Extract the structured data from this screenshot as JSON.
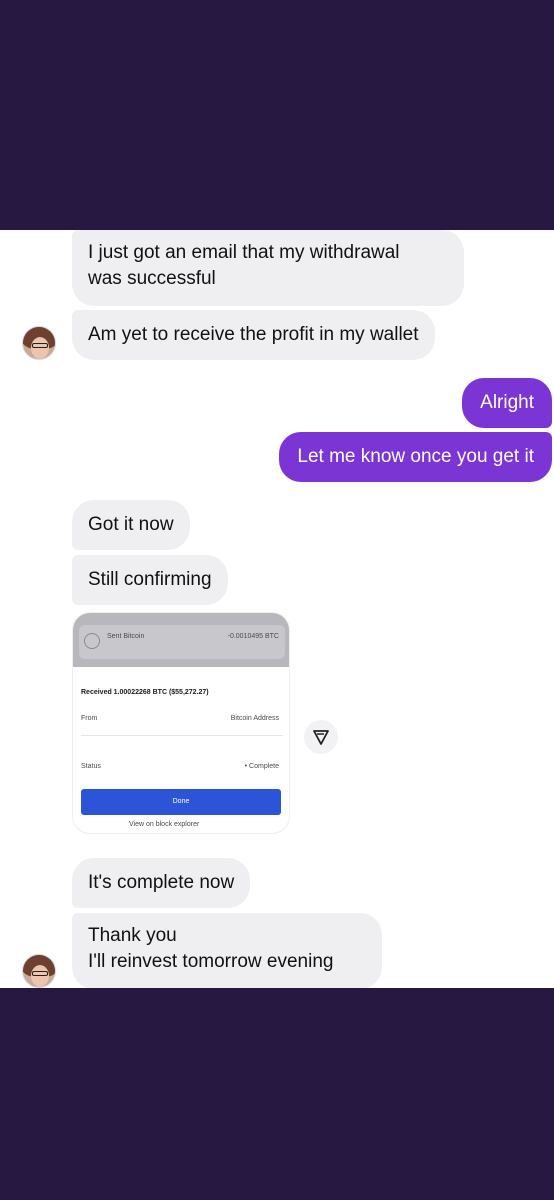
{
  "messages": {
    "m1": {
      "line1": "I just got an email that my withdrawal",
      "line2": "was successful"
    },
    "m2": "Am yet to receive the profit in my wallet",
    "m3": "Alright",
    "m4": "Let me know once you get it",
    "m5": "Got it now",
    "m6": "Still confirming",
    "m7": "It's complete now",
    "m8": {
      "line1": "Thank you",
      "line2": "I'll reinvest tomorrow evening"
    }
  },
  "embedded_screenshot": {
    "asset_label": "Sent Bitcoin",
    "asset_amount": "-0.0010495 BTC",
    "received_line": "Received 1.00022268 BTC ($55,272.27)",
    "from_label": "From",
    "from_value": "Bitcoin Address",
    "status_label": "Status",
    "status_value": "• Complete",
    "done_label": "Done",
    "explorer_link": "View on block explorer"
  },
  "icons": {
    "share": "share-icon",
    "avatar": "contact-avatar"
  },
  "colors": {
    "outgoing_bubble": "#7b35d4",
    "incoming_bubble": "#efeff1",
    "background_bars": "#261840",
    "done_button": "#2b55d6"
  }
}
